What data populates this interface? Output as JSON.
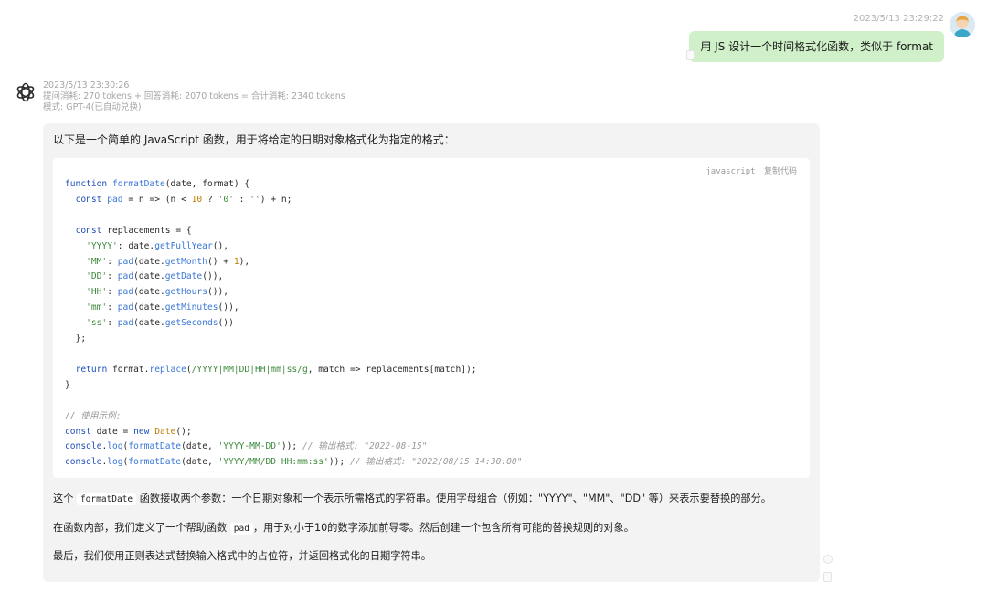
{
  "user_message": {
    "timestamp": "2023/5/13 23:29:22",
    "text": "用 JS 设计一个时间格式化函数，类似于 format",
    "avatar_icon": "user-avatar-icon"
  },
  "assistant_message": {
    "timestamp": "2023/5/13 23:30:26",
    "usage": "提问消耗: 270 tokens + 回答消耗: 2070 tokens = 合计消耗: 2340 tokens",
    "mode": "模式: GPT-4(已自动兑换)",
    "avatar_icon": "openai-logo-icon",
    "intro": "以下是一个简单的 JavaScript 函数，用于将给定的日期对象格式化为指定的格式：",
    "code_block": {
      "language": "javascript",
      "copy_label": "复制代码",
      "lines": [
        "function formatDate(date, format) {",
        "  const pad = n => (n < 10 ? '0' : '') + n;",
        "",
        "  const replacements = {",
        "    'YYYY': date.getFullYear(),",
        "    'MM': pad(date.getMonth() + 1),",
        "    'DD': pad(date.getDate()),",
        "    'HH': pad(date.getHours()),",
        "    'mm': pad(date.getMinutes()),",
        "    'ss': pad(date.getSeconds())",
        "  };",
        "",
        "  return format.replace(/YYYY|MM|DD|HH|mm|ss/g, match => replacements[match]);",
        "}",
        "",
        "// 使用示例:",
        "const date = new Date();",
        "console.log(formatDate(date, 'YYYY-MM-DD')); // 输出格式: \"2022-08-15\"",
        "console.log(formatDate(date, 'YYYY/MM/DD HH:mm:ss')); // 输出格式: \"2022/08/15 14:30:00\""
      ]
    },
    "para1_a": "这个 ",
    "para1_code": "formatDate",
    "para1_b": " 函数接收两个参数：一个日期对象和一个表示所需格式的字符串。使用字母组合（例如：\"YYYY\"、\"MM\"、\"DD\" 等）来表示要替换的部分。",
    "para2_a": "在函数内部，我们定义了一个帮助函数 ",
    "para2_code": "pad",
    "para2_b": "，用于对小于10的数字添加前导零。然后创建一个包含所有可能的替换规则的对象。",
    "para3": "最后，我们使用正则表达式替换输入格式中的占位符，并返回格式化的日期字符串。"
  }
}
